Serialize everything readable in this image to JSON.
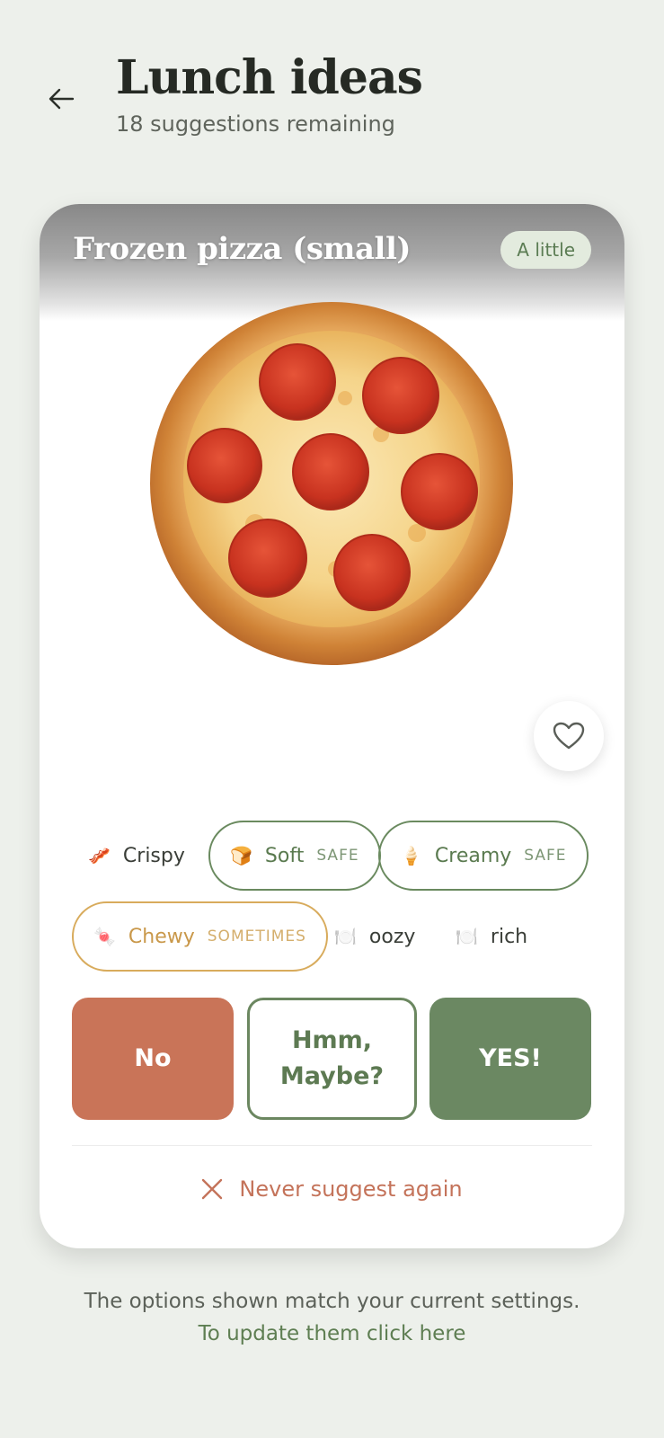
{
  "header": {
    "title": "Lunch ideas",
    "subtitle": "18 suggestions remaining"
  },
  "card": {
    "food_name": "Frozen pizza (small)",
    "amount_label": "A little"
  },
  "textures": [
    {
      "emoji": "🥓",
      "label": "Crispy",
      "tag": "",
      "style": "plain"
    },
    {
      "emoji": "🍞",
      "label": "Soft",
      "tag": "SAFE",
      "style": "safe"
    },
    {
      "emoji": "🍦",
      "label": "Creamy",
      "tag": "SAFE",
      "style": "safe"
    },
    {
      "emoji": "🍬",
      "label": "Chewy",
      "tag": "SOMETIMES",
      "style": "sometimes"
    },
    {
      "emoji": "🍽️",
      "label": "oozy",
      "tag": "",
      "style": "plain"
    },
    {
      "emoji": "🍽️",
      "label": "rich",
      "tag": "",
      "style": "plain"
    }
  ],
  "choices": {
    "no": "No",
    "maybe": "Hmm, Maybe?",
    "yes": "YES!"
  },
  "never_label": "Never suggest again",
  "footer": {
    "text": "The options shown match your current settings.",
    "link": "To update them click here"
  },
  "colors": {
    "background": "#edf0eb",
    "no": "#c97458",
    "yes": "#6b8862",
    "accent_green": "#5e7e52",
    "sometimes": "#d8ab5c"
  }
}
